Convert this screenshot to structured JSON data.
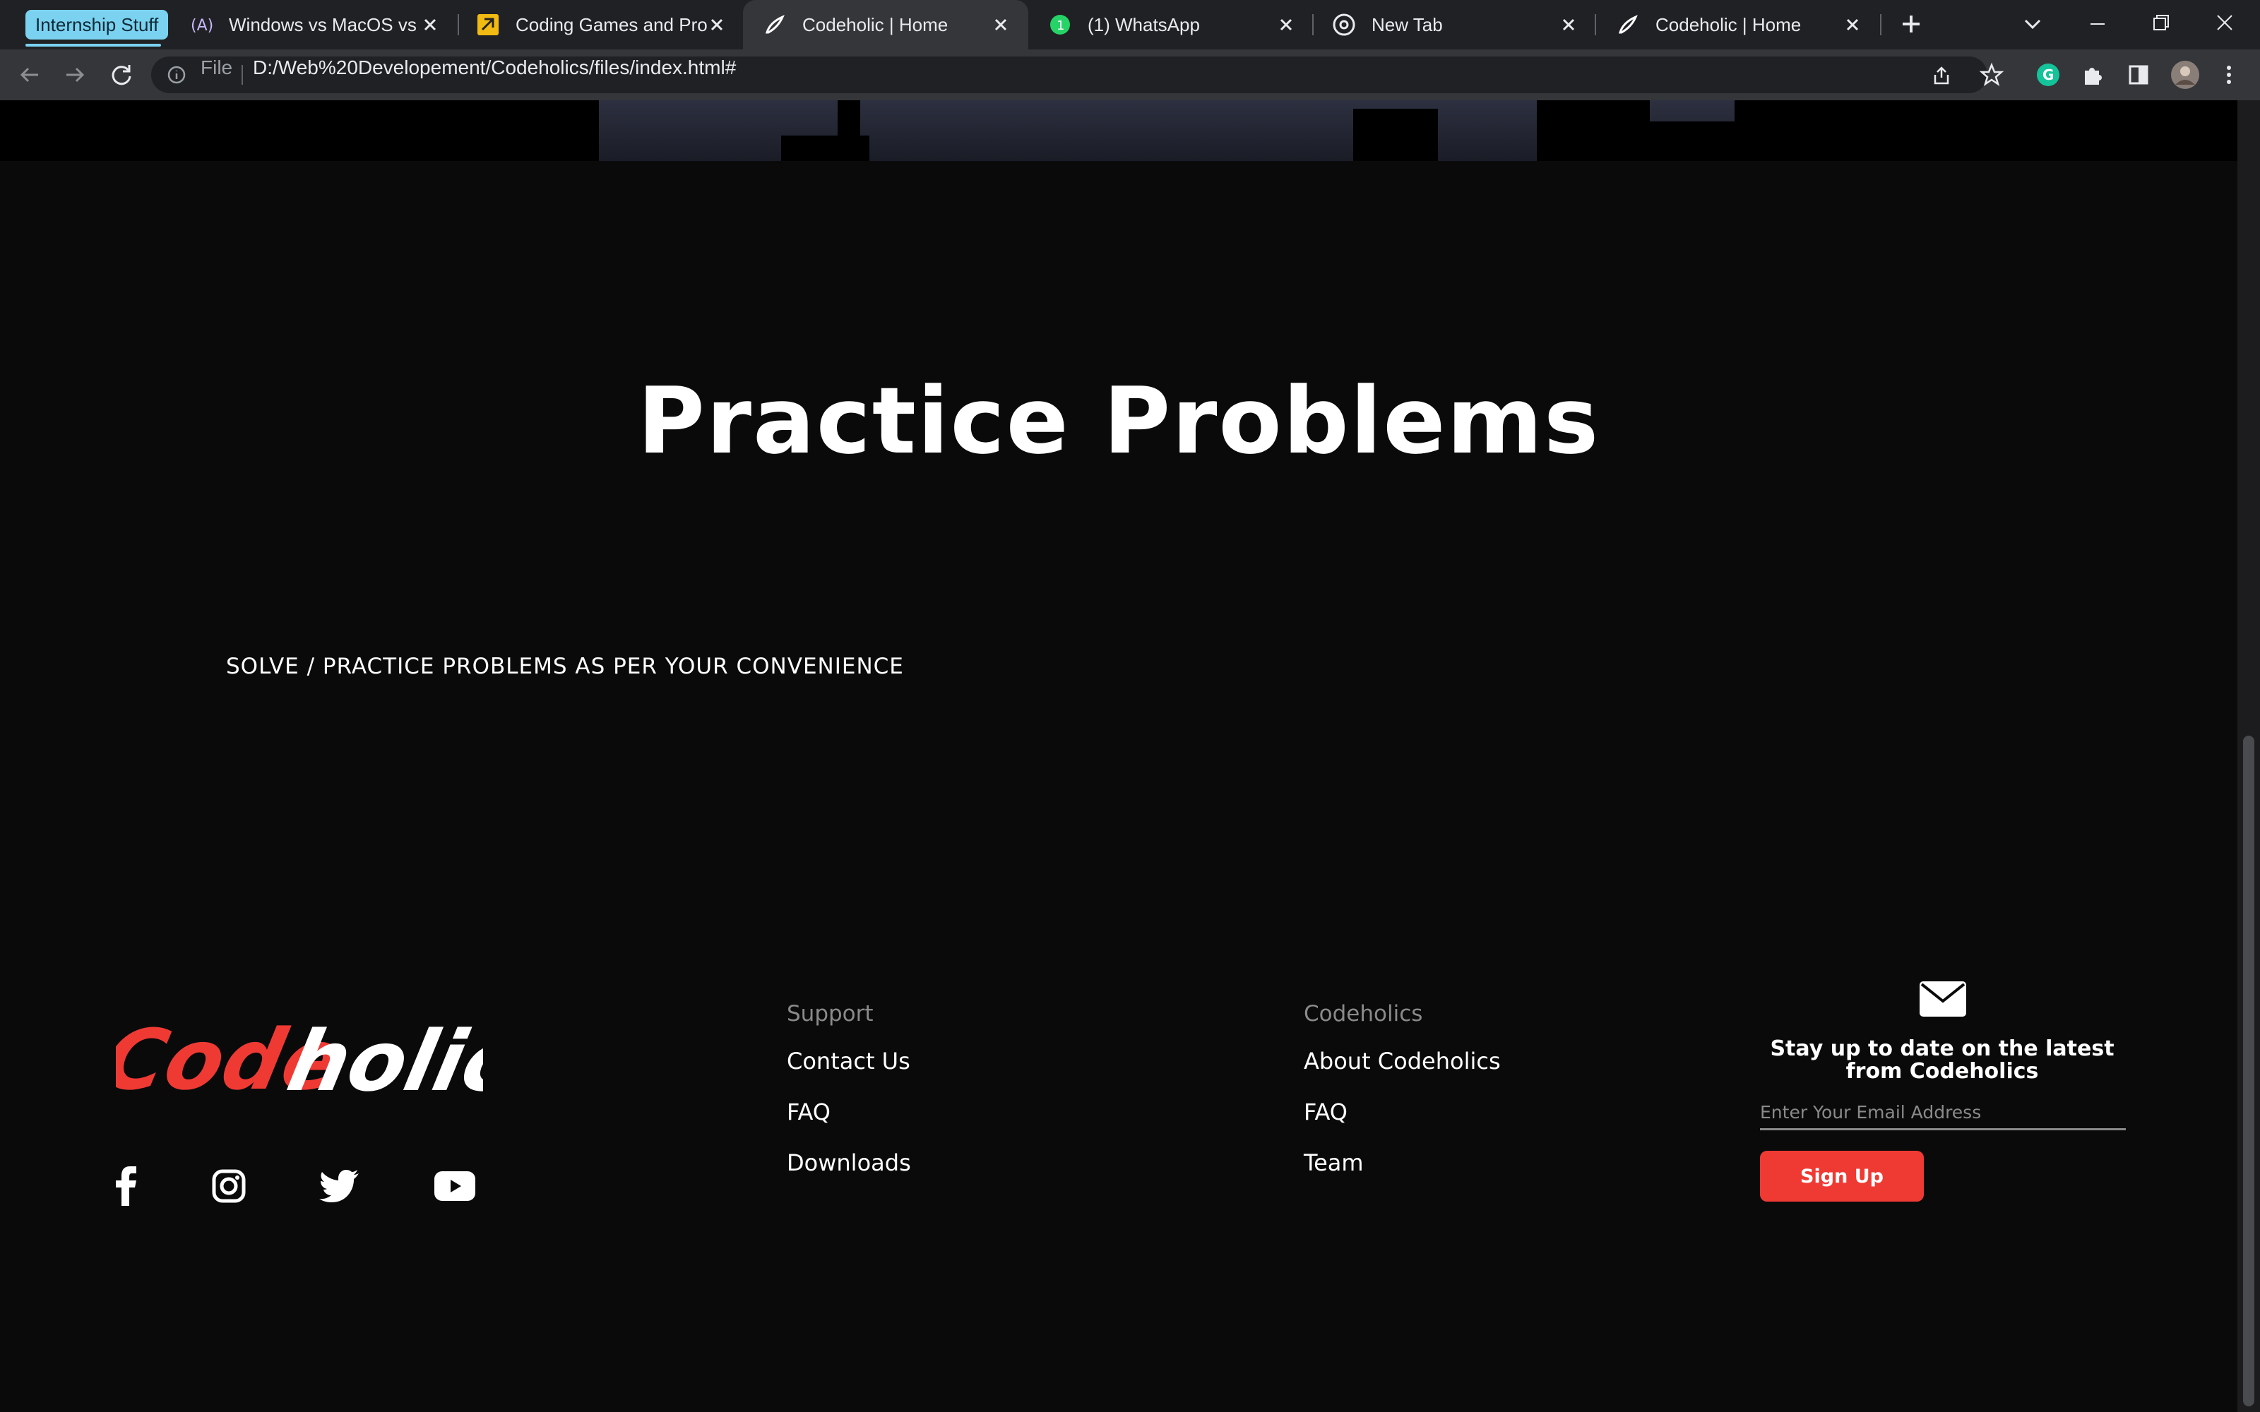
{
  "browser": {
    "tab_group_label": "Internship Stuff",
    "tabs": [
      {
        "title": "Windows vs MacOS vs Linux",
        "icon": "a-logo-icon"
      },
      {
        "title": "Coding Games and Programming",
        "icon": "codingame-icon"
      },
      {
        "title": "Codeholic | Home",
        "icon": "pen-icon",
        "active": true
      },
      {
        "title": "(1) WhatsApp",
        "icon": "whatsapp-icon"
      },
      {
        "title": "New Tab",
        "icon": "chrome-icon"
      },
      {
        "title": "Codeholic | Home",
        "icon": "pen-icon"
      }
    ],
    "file_label": "File",
    "url": "D:/Web%20Developement/Codeholics/files/index.html#"
  },
  "section": {
    "title": "Practice Problems",
    "subtitle": "SOLVE / PRACTICE PROBLEMS AS PER YOUR CONVENIENCE"
  },
  "footer": {
    "logo_text_red": "Code",
    "logo_text_white": "holics",
    "socials": [
      "facebook-icon",
      "instagram-icon",
      "twitter-icon",
      "youtube-icon"
    ],
    "support": {
      "heading": "Support",
      "links": [
        "Contact Us",
        "FAQ",
        "Downloads"
      ]
    },
    "codeholics": {
      "heading": "Codeholics",
      "links": [
        "About Codeholics",
        "FAQ",
        "Team"
      ]
    },
    "newsletter": {
      "text": "Stay up to date on the latest from Codeholics",
      "email_placeholder": "Enter Your Email Address",
      "button": "Sign Up"
    }
  },
  "colors": {
    "accent_red": "#ef3a34",
    "tab_group": "#7ad2f0",
    "background": "#0a0a0b"
  }
}
